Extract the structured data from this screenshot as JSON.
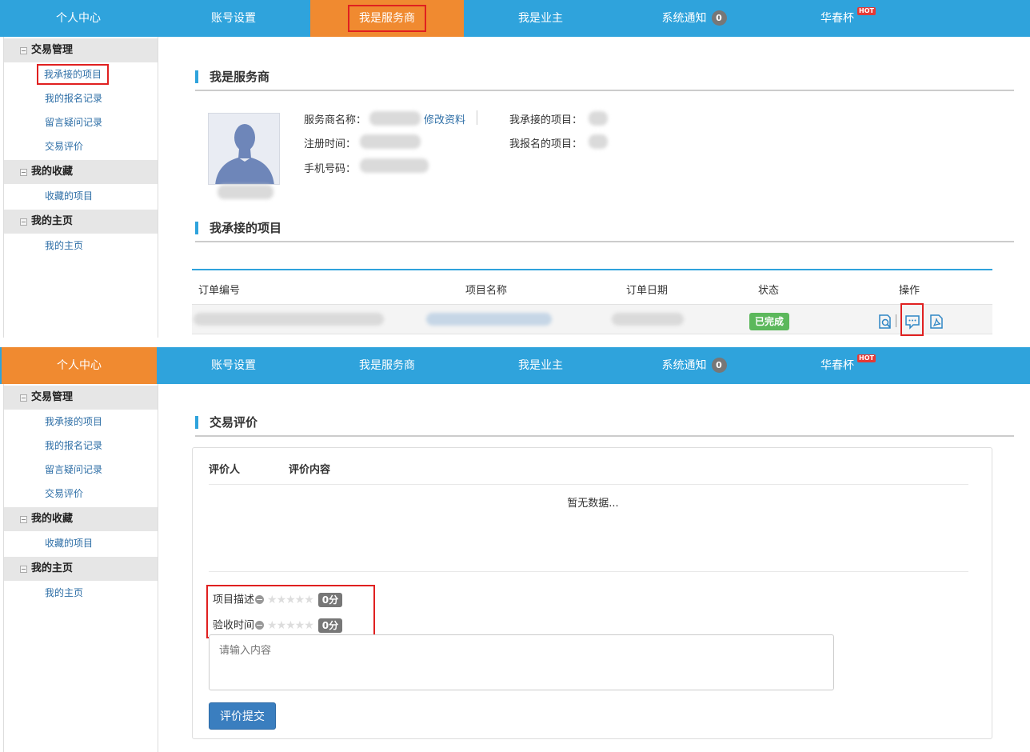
{
  "nav": {
    "items": [
      {
        "label": "个人中心"
      },
      {
        "label": "账号设置"
      },
      {
        "label": "我是服务商"
      },
      {
        "label": "我是业主"
      },
      {
        "label": "系统通知",
        "badge": "0"
      },
      {
        "label": "华春杯",
        "hot": "HOT"
      }
    ]
  },
  "sidebar": {
    "groups": [
      {
        "title": "交易管理",
        "items": [
          "我承接的项目",
          "我的报名记录",
          "留言疑问记录",
          "交易评价"
        ]
      },
      {
        "title": "我的收藏",
        "items": [
          "收藏的项目"
        ]
      },
      {
        "title": "我的主页",
        "items": [
          "我的主页"
        ]
      }
    ]
  },
  "provider": {
    "title": "我是服务商",
    "name_label": "服务商名称：",
    "edit_link": "修改资料",
    "reg_label": "注册时间：",
    "phone_label": "手机号码：",
    "taken_label": "我承接的项目：",
    "signed_label": "我报名的项目："
  },
  "projects": {
    "title": "我承接的项目",
    "columns": [
      "订单编号",
      "项目名称",
      "订单日期",
      "状态",
      "操作"
    ],
    "row_status": "已完成"
  },
  "review": {
    "title": "交易评价",
    "col_reviewer": "评价人",
    "col_content": "评价内容",
    "empty": "暂无数据...",
    "ratings": [
      {
        "label": "项目描述",
        "stars": "★★★★★",
        "score": "0分"
      },
      {
        "label": "验收时间",
        "stars": "★★★★★",
        "score": "0分"
      }
    ],
    "placeholder": "请输入内容",
    "submit": "评价提交"
  }
}
